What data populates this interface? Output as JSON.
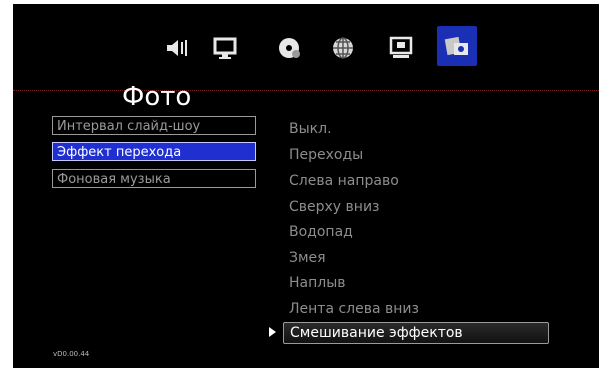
{
  "icons": [
    "volume-icon",
    "display-icon",
    "disc-icon",
    "network-icon",
    "system-icon",
    "photo-icon"
  ],
  "page": {
    "title": "Фото"
  },
  "settings": [
    {
      "label": "Интервал слайд-шоу",
      "active": false
    },
    {
      "label": "Эффект перехода",
      "active": true
    },
    {
      "label": "Фоновая музыка",
      "active": false
    }
  ],
  "options": [
    "Выкл.",
    "Переходы",
    "Слева направо",
    "Сверху вниз",
    "Водопад",
    "Змея",
    "Наплыв",
    "Лента слева вниз",
    "Смешивание эффектов"
  ],
  "selected_option": "Смешивание эффектов",
  "version": "vD0.00.44",
  "colors": {
    "highlight": "#1f2fd0",
    "tab_selected": "#1a2fb4",
    "background": "#000000"
  }
}
